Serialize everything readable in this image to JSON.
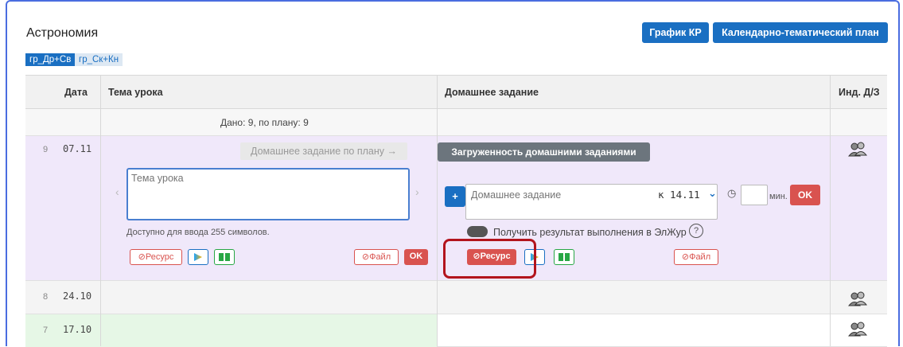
{
  "subject": "Астрономия",
  "buttons": {
    "schedule_kr": "График КР",
    "calendar_plan": "Календарно-тематический план"
  },
  "groups": [
    {
      "label": "гр_Др+Св",
      "active": true
    },
    {
      "label": "гр_Ск+Кн",
      "active": false
    }
  ],
  "table": {
    "headers": {
      "date": "Дата",
      "topic": "Тема урока",
      "homework": "Домашнее задание",
      "ind": "Инд. Д/З"
    },
    "summary": "Дано: 9, по плану: 9",
    "rows": [
      {
        "num": "9",
        "date": "07.11"
      },
      {
        "num": "8",
        "date": "24.10"
      },
      {
        "num": "7",
        "date": "17.10"
      }
    ]
  },
  "editor": {
    "hw_by_plan": "Домашнее задание по плану",
    "topic_placeholder": "Тема урока",
    "char_limit": "Доступно для ввода 255 символов.",
    "resource": "Ресурс",
    "file": "Файл",
    "ok": "OK"
  },
  "homework": {
    "workload": "Загруженность домашними заданиями",
    "plus": "+",
    "placeholder": "Домашнее задание",
    "due_prefix": "к 14.11",
    "minutes_suffix": "мин.",
    "ok": "OK",
    "get_result": "Получить результат выполнения в ЭлЖур",
    "help": "?",
    "resource": "Ресурс",
    "file": "Файл"
  },
  "colors": {
    "accent": "#1a6fc2",
    "danger": "#d9534f",
    "active_row": "#f0e8fa",
    "green_row": "#e6f7e6"
  }
}
